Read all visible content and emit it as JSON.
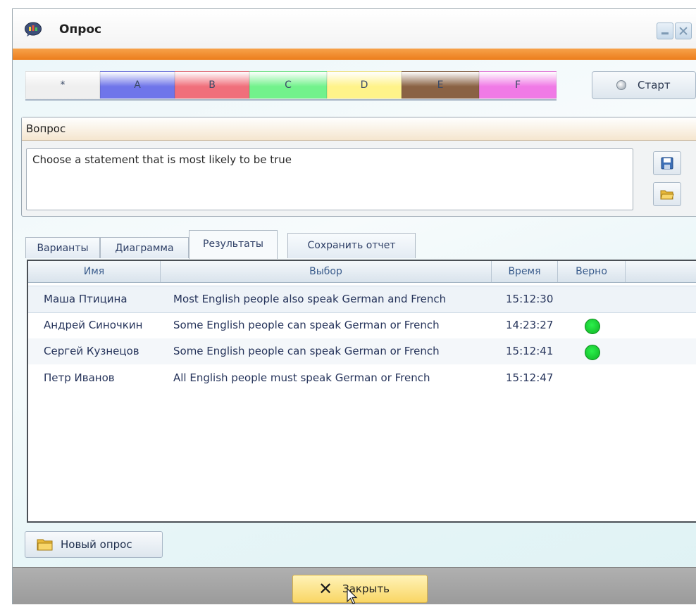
{
  "window": {
    "title": "Опрос"
  },
  "options": {
    "items": [
      {
        "label": "*",
        "color": "#efefef"
      },
      {
        "label": "A",
        "color": "#6f75ea"
      },
      {
        "label": "B",
        "color": "#f06f7b"
      },
      {
        "label": "C",
        "color": "#72f28c"
      },
      {
        "label": "D",
        "color": "#fff38a"
      },
      {
        "label": "E",
        "color": "#8a6244"
      },
      {
        "label": "F",
        "color": "#f07ae6"
      }
    ],
    "start_label": "Старт"
  },
  "question": {
    "header": "Вопрос",
    "text": "Choose a statement that is most likely to be true"
  },
  "tabs": {
    "options": "Варианты",
    "diagram": "Диаграмма",
    "results": "Результаты",
    "save_report": "Сохранить отчет"
  },
  "results": {
    "columns": {
      "name": "Имя",
      "choice": "Выбор",
      "time": "Время",
      "correct": "Верно"
    },
    "rows": [
      {
        "name": "Маша Птицина",
        "choice": "Most English people also speak German and French",
        "time": "15:12:30",
        "correct": false
      },
      {
        "name": "Андрей Синочкин",
        "choice": "Some English people can speak German or French",
        "time": "14:23:27",
        "correct": true
      },
      {
        "name": "Сергей Кузнецов",
        "choice": "Some English people can speak German or French",
        "time": "15:12:41",
        "correct": true
      },
      {
        "name": "Петр Иванов",
        "choice": "All English people must speak German or French",
        "time": "15:12:47",
        "correct": false
      }
    ]
  },
  "new_poll_label": "Новый опрос",
  "close_label": "Закрыть",
  "colors": {
    "accent": "#ec7d1c",
    "correct": "#1fd33a",
    "footer": "#a6a6a6"
  }
}
